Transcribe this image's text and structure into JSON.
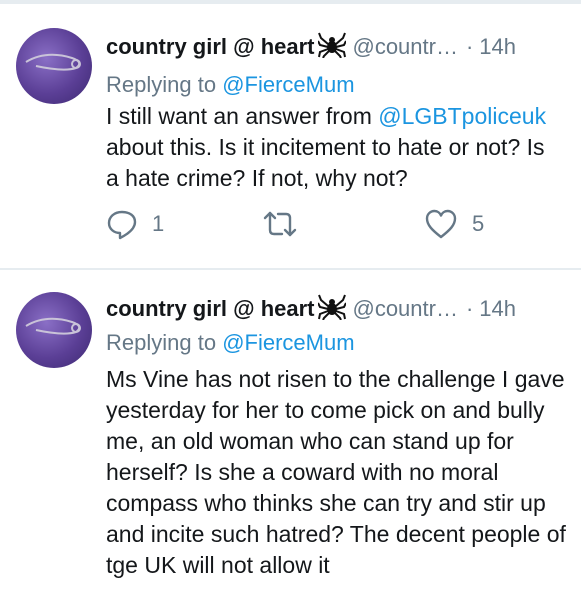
{
  "tweets": [
    {
      "author_name": "country girl @ heart",
      "handle": "@countr…",
      "separator": "·",
      "time": "14h",
      "replying_prefix": "Replying to",
      "replying_to": "@FierceMum",
      "lines": [
        {
          "pre": "I still want an answer from ",
          "link": "@LGBTpoliceuk",
          "post": ""
        },
        {
          "pre": "about this. Is it incitement to hate or not? Is",
          "link": "",
          "post": ""
        },
        {
          "pre": "a hate crime? If not, why not?",
          "link": "",
          "post": ""
        }
      ],
      "actions": {
        "reply_icon": "reply-icon",
        "reply_count": "1",
        "retweet_icon": "retweet-icon",
        "like_icon": "heart-icon",
        "like_count": "5"
      }
    },
    {
      "author_name": "country girl @ heart",
      "handle": "@countr…",
      "separator": "·",
      "time": "14h",
      "replying_prefix": "Replying to",
      "replying_to": "@FierceMum",
      "lines": [
        {
          "pre": "Ms Vine has not risen to the challenge I gave",
          "link": "",
          "post": ""
        },
        {
          "pre": "yesterday for her to come pick on and bully",
          "link": "",
          "post": ""
        },
        {
          "pre": "me, an old woman who can stand up for",
          "link": "",
          "post": ""
        },
        {
          "pre": "herself? Is she a coward with no moral",
          "link": "",
          "post": ""
        },
        {
          "pre": "compass who thinks she can try and stir up",
          "link": "",
          "post": ""
        },
        {
          "pre": "and incite such hatred? The decent people of",
          "link": "",
          "post": ""
        },
        {
          "pre": "tge UK will not allow it",
          "link": "",
          "post": ""
        }
      ]
    }
  ],
  "colors": {
    "link": "#1b95e0",
    "muted": "#657786",
    "text": "#14171a",
    "divider": "#e6ecf0"
  }
}
